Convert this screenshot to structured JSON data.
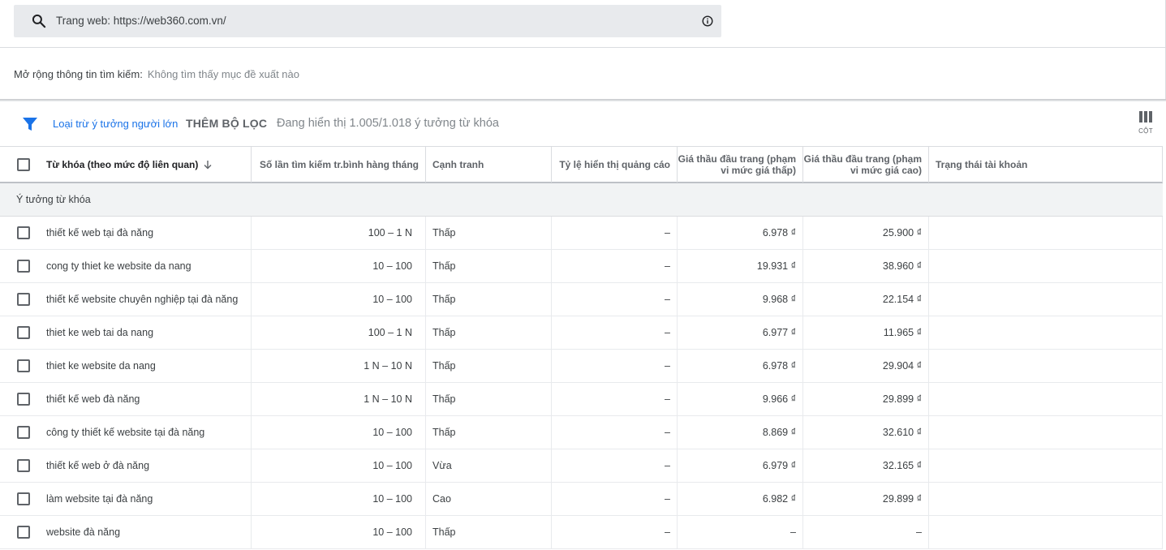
{
  "search": {
    "label": "Trang web: https://web360.com.vn/"
  },
  "expand": {
    "label": "Mở rộng thông tin tìm kiếm:",
    "value": "Không tìm thấy mục đề xuất nào"
  },
  "filters": {
    "exclude_adult": "Loại trừ ý tưởng người lớn",
    "add_filter": "THÊM BỘ LỌC",
    "showing": "Đang hiển thị 1.005/1.018 ý tưởng từ khóa",
    "columns_label": "CỘT"
  },
  "colors": {
    "accent": "#1a73e8",
    "search_bg": "#e8eaed",
    "group_bg": "#f1f3f4"
  },
  "table": {
    "headers": {
      "keyword": "Từ khóa (theo mức độ liên quan)",
      "avg_searches": "Số lần tìm kiếm tr.bình hàng tháng",
      "competition": "Cạnh tranh",
      "impression_share": "Tỷ lệ hiển thị quảng cáo",
      "bid_low": "Giá thầu đầu trang (phạm vi mức giá thấp)",
      "bid_high": "Giá thầu đầu trang (phạm vi mức giá cao)",
      "account_status": "Trạng thái tài khoản"
    },
    "group_label": "Ý tưởng từ khóa",
    "rows": [
      {
        "keyword": "thiết kế web tại đà năng",
        "searches": "100 – 1 N",
        "competition": "Thấp",
        "share": "–",
        "low": "6.978 ₫",
        "high": "25.900 ₫",
        "status": ""
      },
      {
        "keyword": "cong ty thiet ke website da nang",
        "searches": "10 – 100",
        "competition": "Thấp",
        "share": "–",
        "low": "19.931 ₫",
        "high": "38.960 ₫",
        "status": ""
      },
      {
        "keyword": "thiết kế website chuyên nghiệp tại đà năng",
        "searches": "10 – 100",
        "competition": "Thấp",
        "share": "–",
        "low": "9.968 ₫",
        "high": "22.154 ₫",
        "status": ""
      },
      {
        "keyword": "thiet ke web tai da nang",
        "searches": "100 – 1 N",
        "competition": "Thấp",
        "share": "–",
        "low": "6.977 ₫",
        "high": "11.965 ₫",
        "status": ""
      },
      {
        "keyword": "thiet ke website da nang",
        "searches": "1 N – 10 N",
        "competition": "Thấp",
        "share": "–",
        "low": "6.978 ₫",
        "high": "29.904 ₫",
        "status": ""
      },
      {
        "keyword": "thiết kế web đà năng",
        "searches": "1 N – 10 N",
        "competition": "Thấp",
        "share": "–",
        "low": "9.966 ₫",
        "high": "29.899 ₫",
        "status": ""
      },
      {
        "keyword": "công ty thiết kế website tại đà năng",
        "searches": "10 – 100",
        "competition": "Thấp",
        "share": "–",
        "low": "8.869 ₫",
        "high": "32.610 ₫",
        "status": ""
      },
      {
        "keyword": "thiết kế web ở đà năng",
        "searches": "10 – 100",
        "competition": "Vừa",
        "share": "–",
        "low": "6.979 ₫",
        "high": "32.165 ₫",
        "status": ""
      },
      {
        "keyword": "làm website tại đà năng",
        "searches": "10 – 100",
        "competition": "Cao",
        "share": "–",
        "low": "6.982 ₫",
        "high": "29.899 ₫",
        "status": ""
      },
      {
        "keyword": "website đà năng",
        "searches": "10 – 100",
        "competition": "Thấp",
        "share": "–",
        "low": "–",
        "high": "–",
        "status": ""
      }
    ]
  }
}
